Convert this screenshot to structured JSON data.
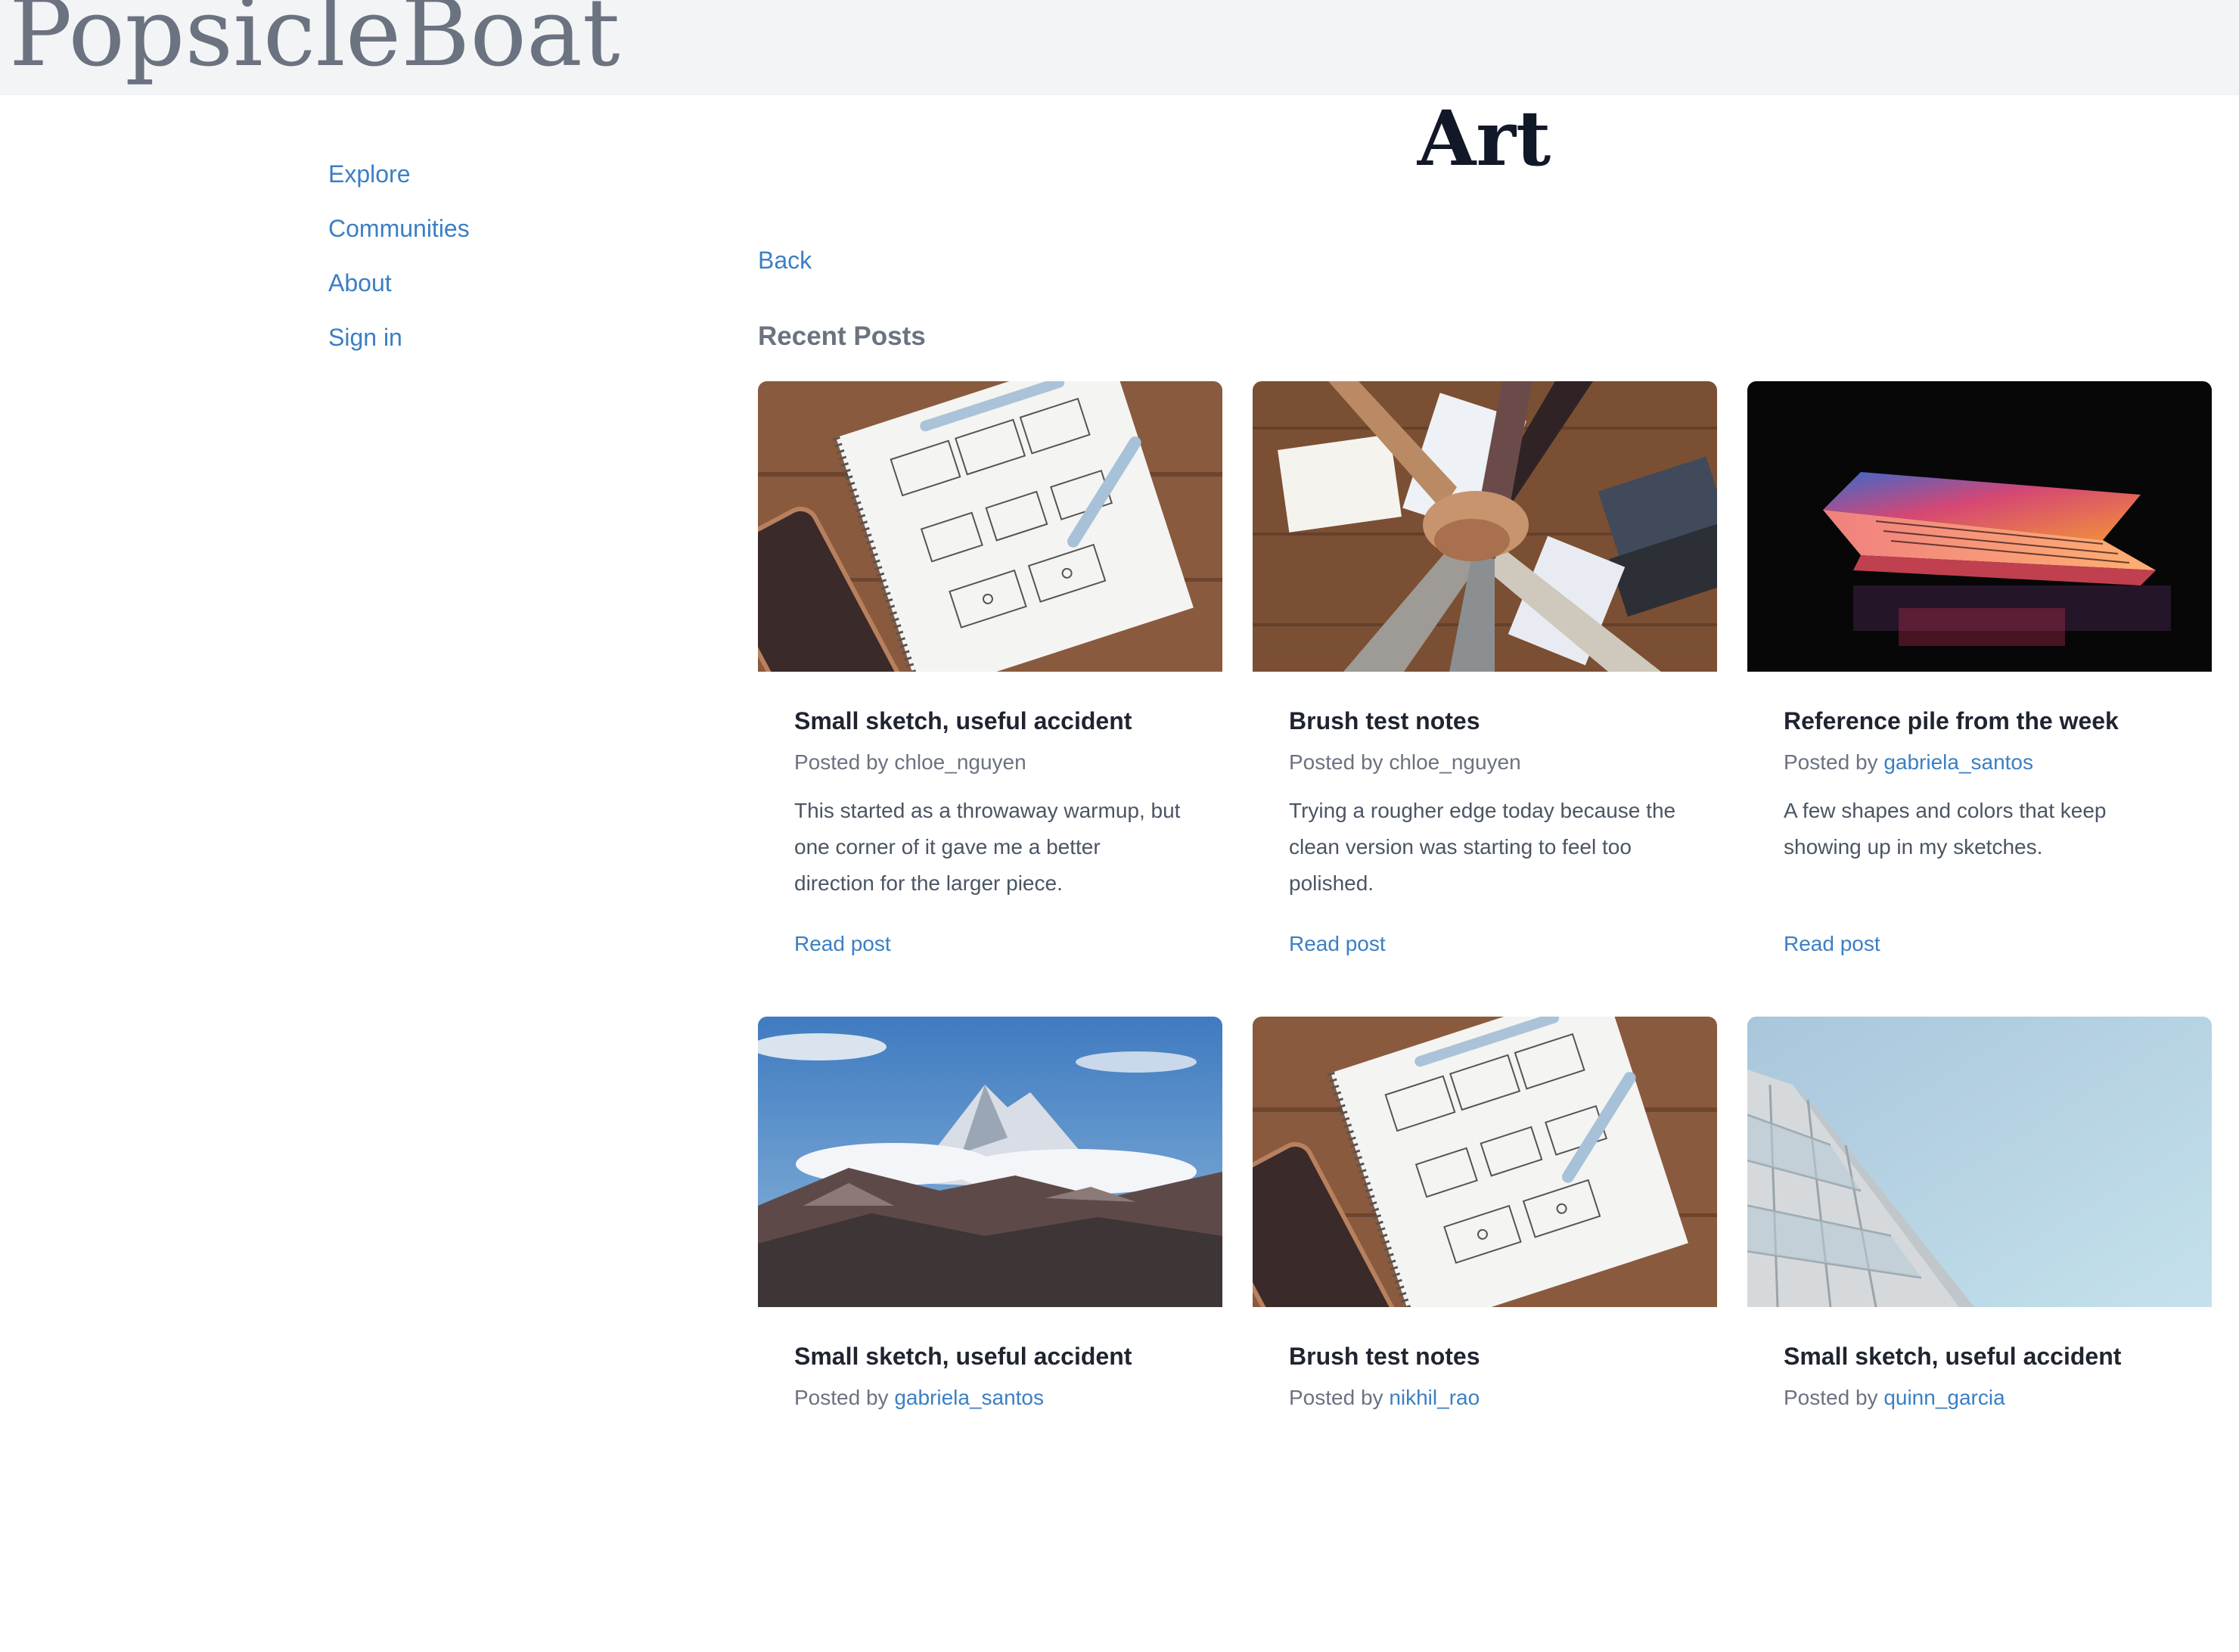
{
  "site": {
    "brand": "PopsicleBoat"
  },
  "sidebar": {
    "items": [
      {
        "label": "Explore"
      },
      {
        "label": "Communities"
      },
      {
        "label": "About"
      },
      {
        "label": "Sign in"
      }
    ]
  },
  "main": {
    "title": "Art",
    "back_label": "Back",
    "section_heading": "Recent Posts",
    "posts": [
      {
        "title": "Small sketch, useful accident",
        "posted_by_prefix": "Posted by ",
        "author": "chloe_nguyen",
        "author_is_link": false,
        "excerpt": "This started as a throwaway warmup, but one corner of it gave me a better direction for the larger piece.",
        "read_label": "Read post",
        "image": "sketch-notebook-image"
      },
      {
        "title": "Brush test notes",
        "posted_by_prefix": "Posted by ",
        "author": "chloe_nguyen",
        "author_is_link": false,
        "excerpt": "Trying a rougher edge today because the clean version was starting to feel too polished.",
        "read_label": "Read post",
        "image": "team-hands-image"
      },
      {
        "title": "Reference pile from the week",
        "posted_by_prefix": "Posted by ",
        "author": "gabriela_santos",
        "author_is_link": true,
        "excerpt": "A few shapes and colors that keep showing up in my sketches.",
        "read_label": "Read post",
        "image": "glowing-laptop-image"
      },
      {
        "title": "Small sketch, useful accident",
        "posted_by_prefix": "Posted by ",
        "author": "gabriela_santos",
        "author_is_link": true,
        "excerpt": "",
        "read_label": "",
        "image": "mountain-peak-image"
      },
      {
        "title": "Brush test notes",
        "posted_by_prefix": "Posted by ",
        "author": "nikhil_rao",
        "author_is_link": true,
        "excerpt": "",
        "read_label": "",
        "image": "sketch-notebook-image"
      },
      {
        "title": "Small sketch, useful accident",
        "posted_by_prefix": "Posted by ",
        "author": "quinn_garcia",
        "author_is_link": true,
        "excerpt": "",
        "read_label": "",
        "image": "building-sky-image"
      }
    ]
  },
  "colors": {
    "link": "#3b7fc4",
    "header_bg": "#f3f4f6",
    "brand_text": "#6b7280",
    "title_text": "#111827"
  }
}
